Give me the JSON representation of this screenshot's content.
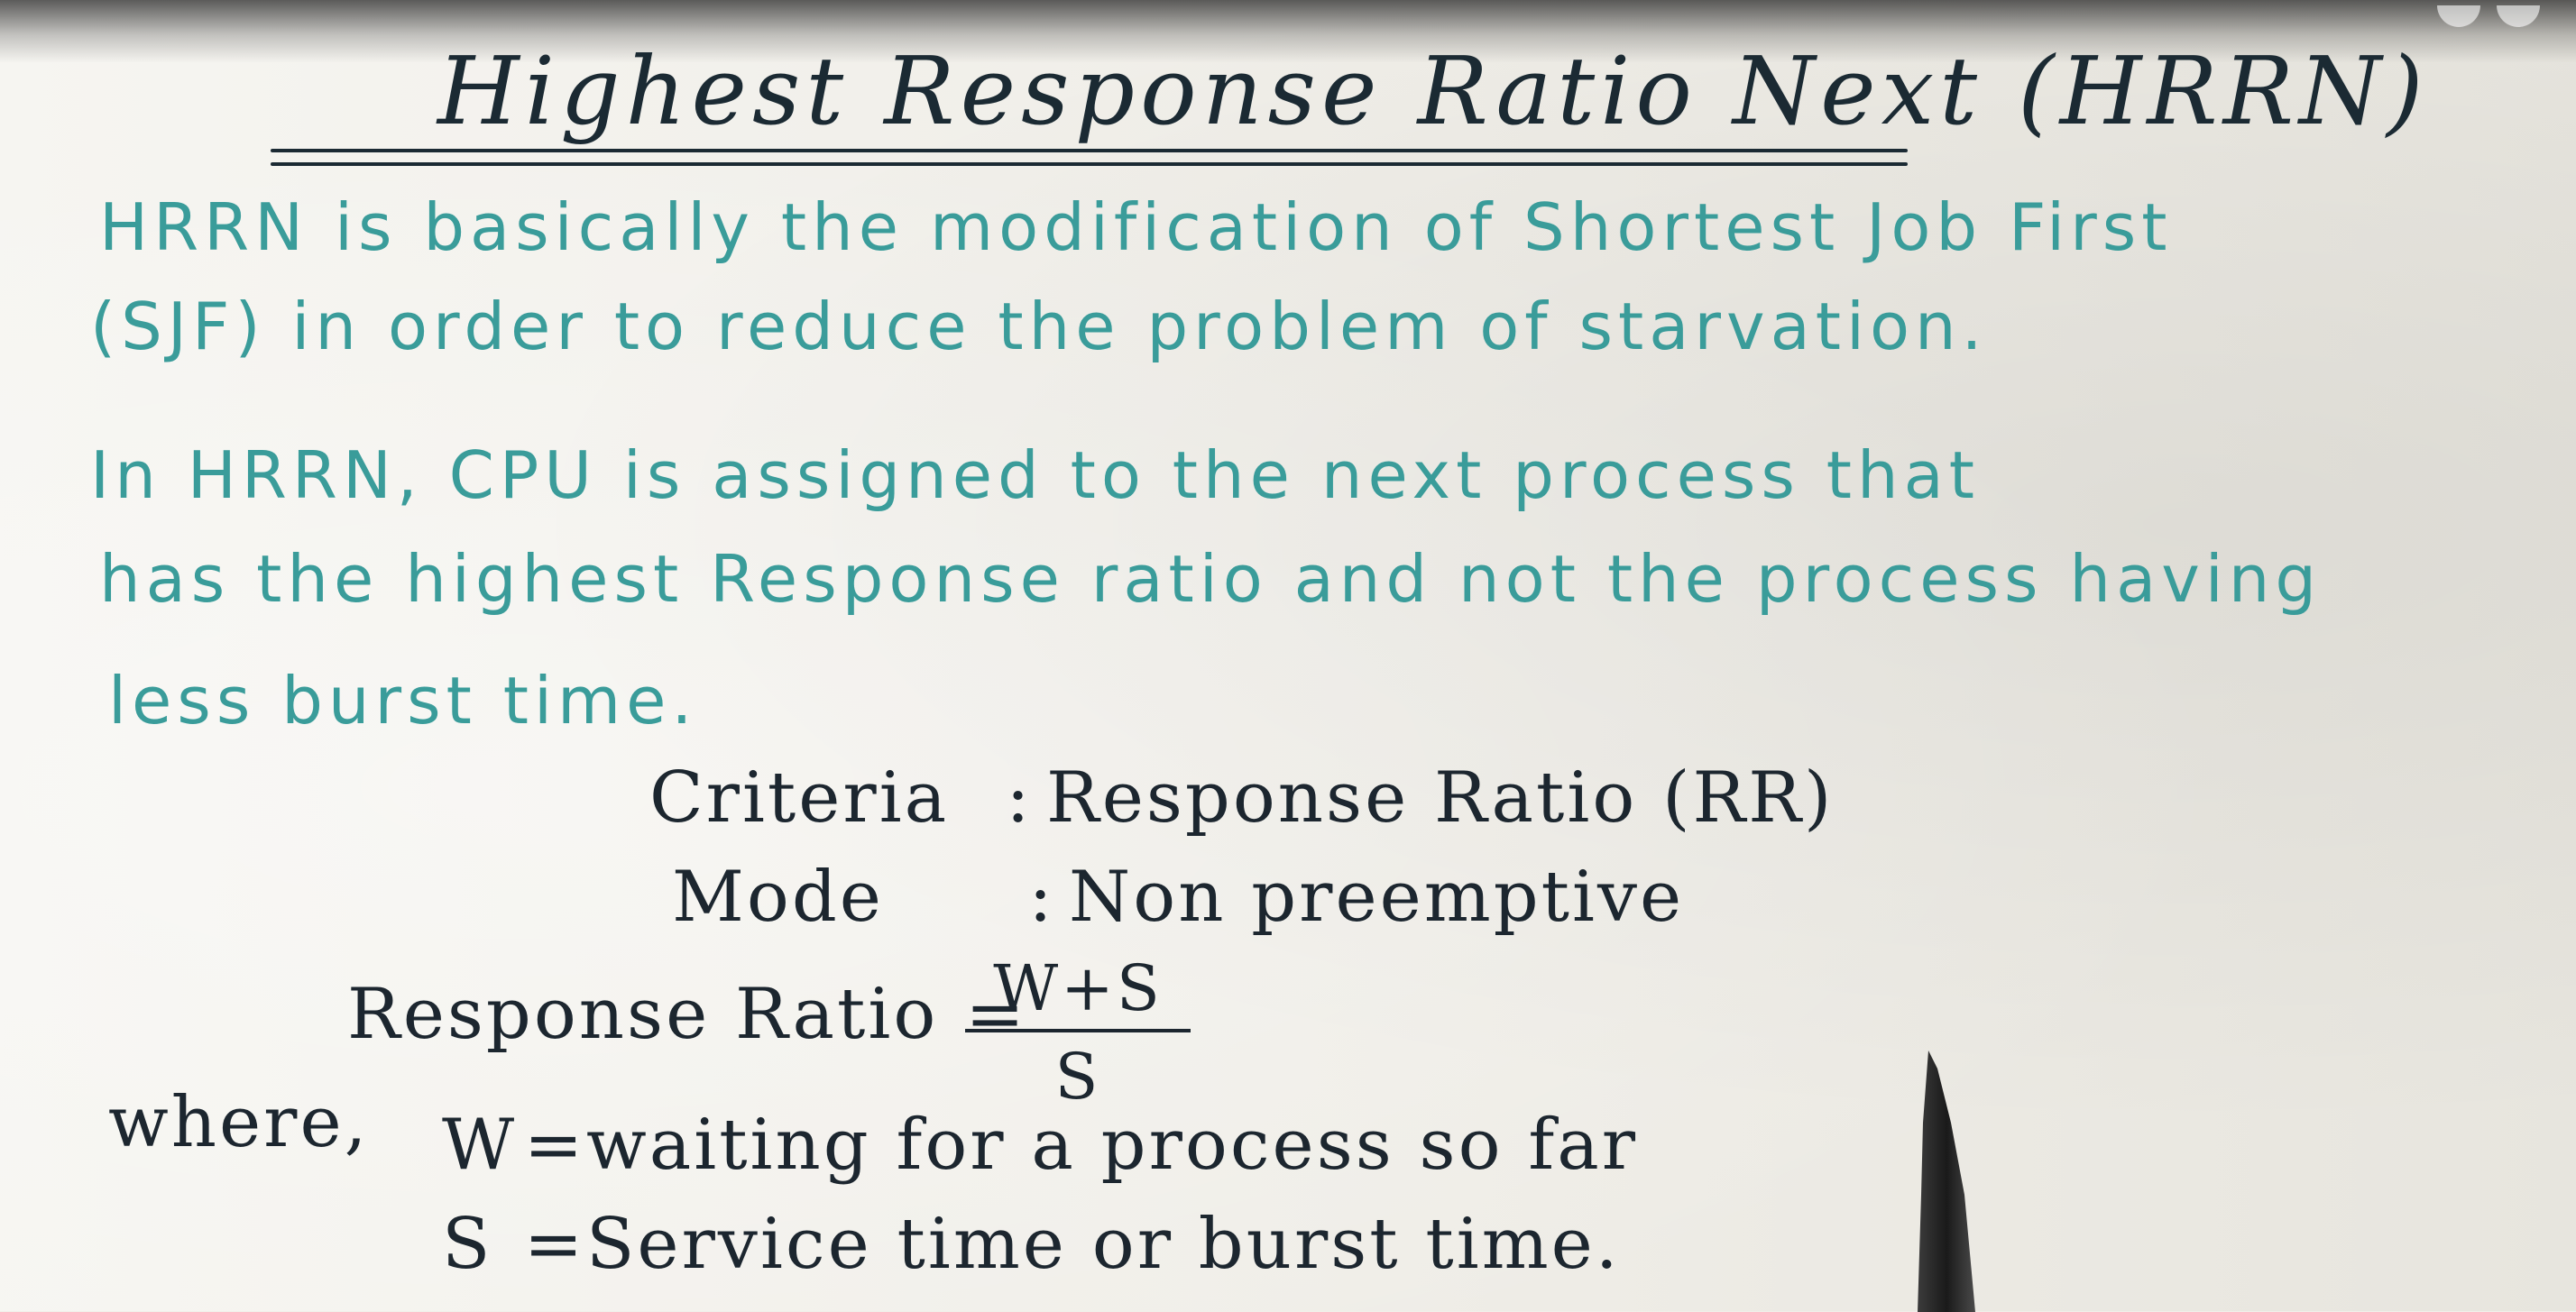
{
  "title": "Highest Response Ratio Next (HRRN)",
  "paragraph1": {
    "line1": "HRRN is basically the modification of Shortest Job First",
    "line2": "(SJF) in order to reduce the problem of starvation."
  },
  "paragraph2": {
    "line1": "In HRRN, CPU is assigned to the next process that",
    "line2": "has the highest Response ratio and not the process having",
    "line3": "less burst time."
  },
  "criteria": {
    "label": "Criteria",
    "separator": ":",
    "value": "Response Ratio (RR)"
  },
  "mode": {
    "label": "Mode",
    "separator": ":",
    "value": "Non preemptive"
  },
  "formula": {
    "left": "Response Ratio",
    "equals": "=",
    "numerator": "W+S",
    "denominator": "S"
  },
  "where": {
    "label": "where,",
    "w_symbol": "W",
    "w_equals": "=",
    "w_definition": "waiting for a process so far",
    "s_symbol": "S",
    "s_equals": "=",
    "s_definition": "Service time or burst time."
  },
  "colors": {
    "teal_ink": "#3a9c9a",
    "dark_ink": "#1c262f",
    "paper": "#f1efe9"
  }
}
